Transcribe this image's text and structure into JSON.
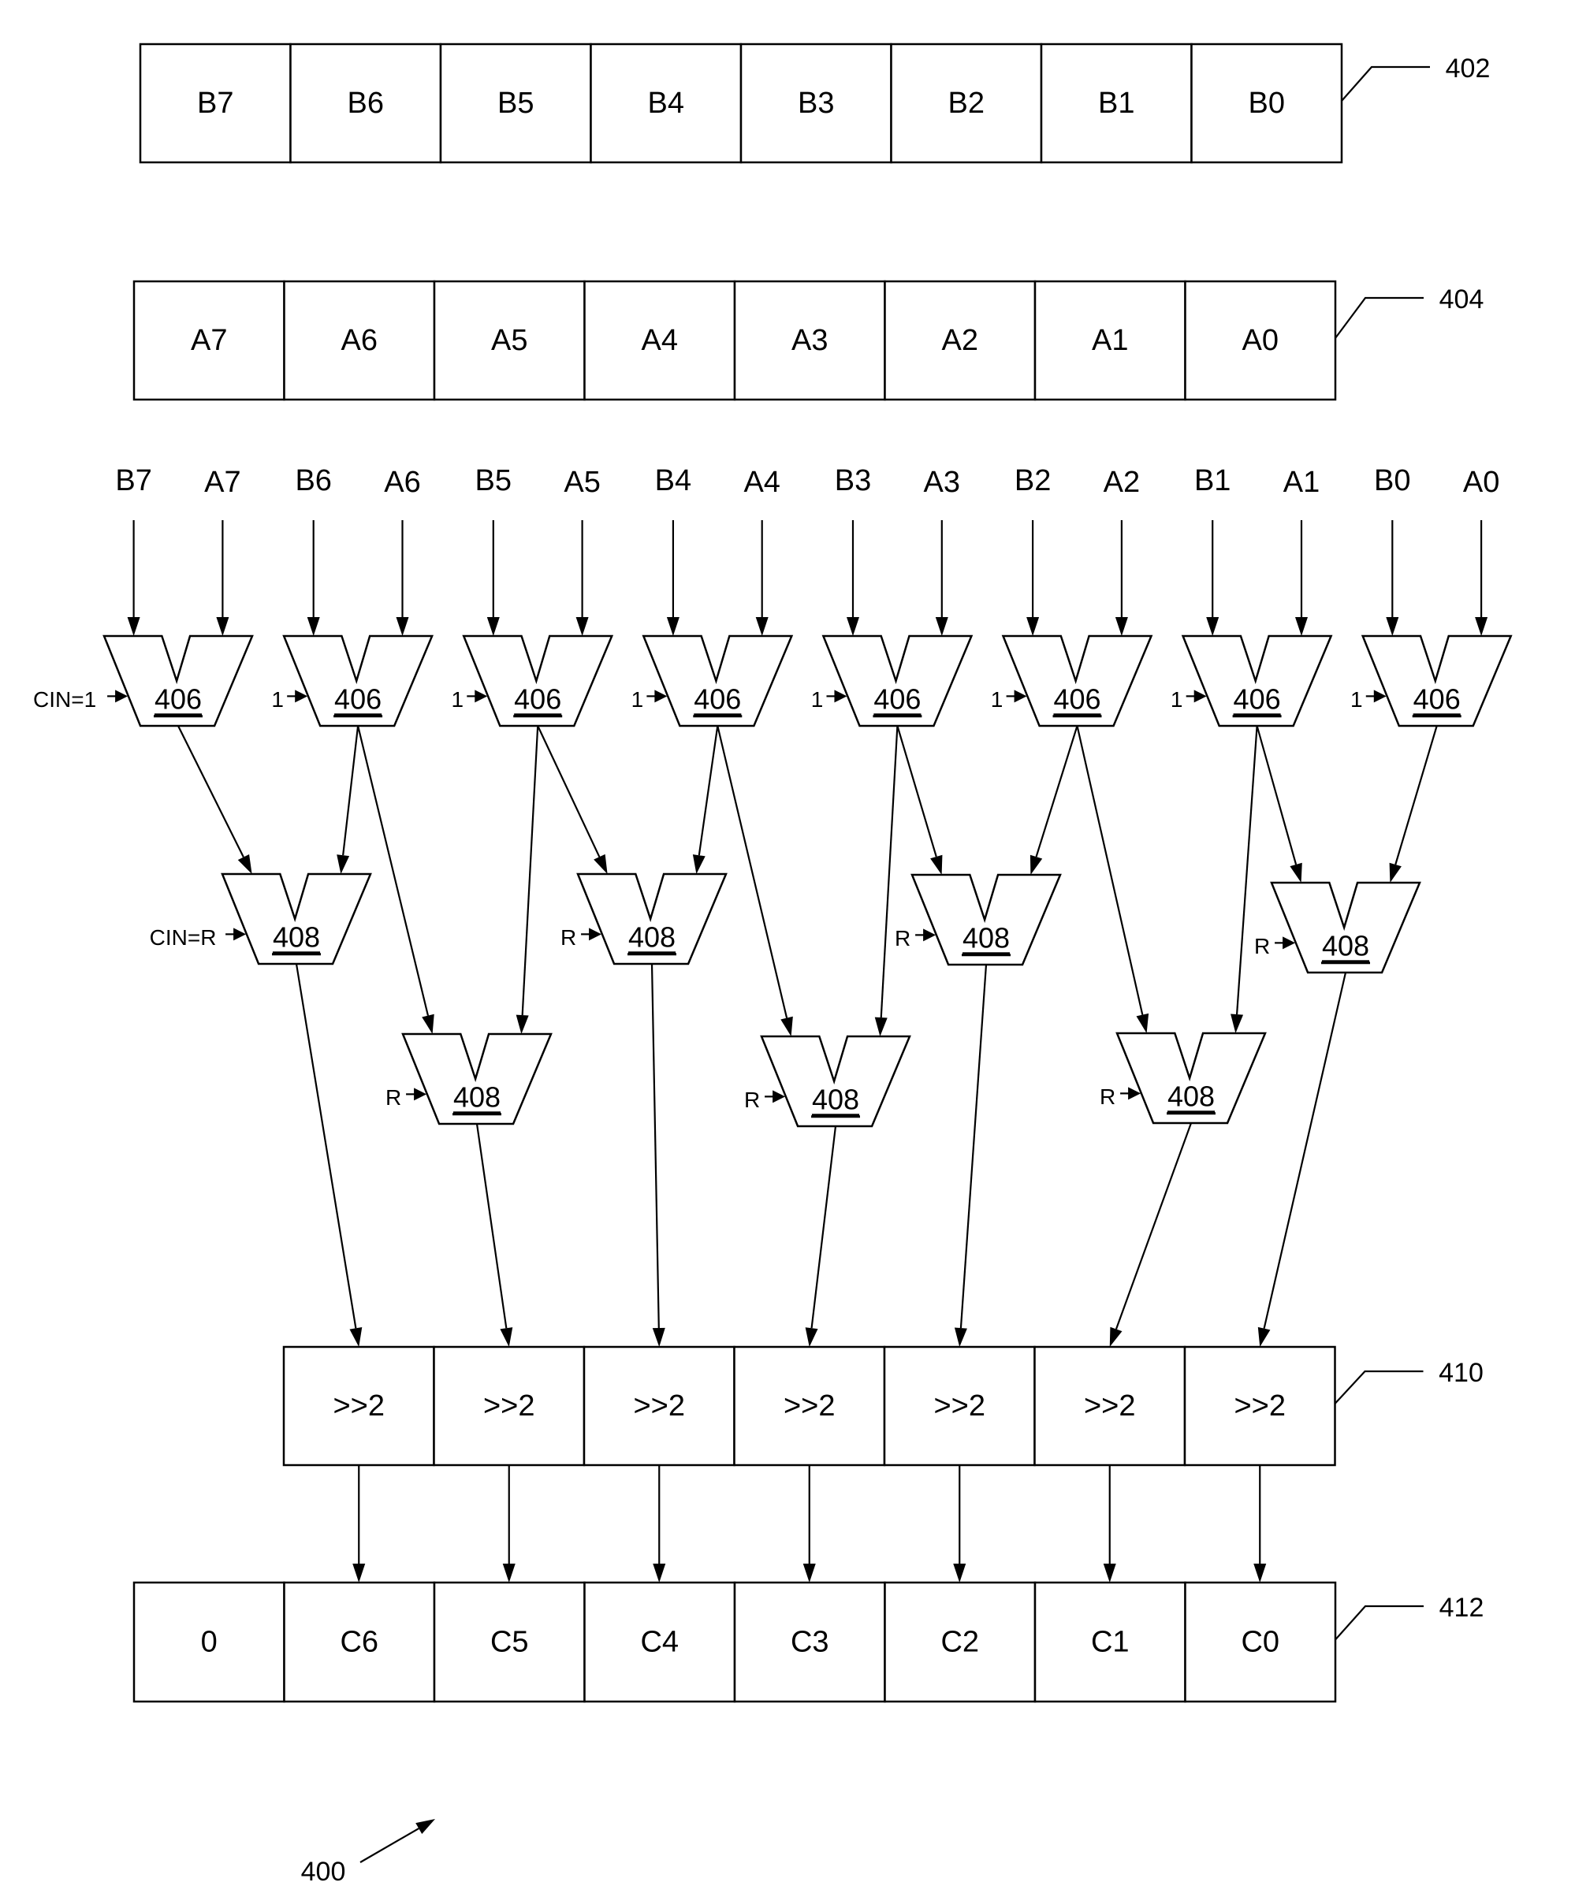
{
  "figure": {
    "reference": "400",
    "registers": {
      "b": {
        "ref": "402",
        "cells": [
          "B7",
          "B6",
          "B5",
          "B4",
          "B3",
          "B2",
          "B1",
          "B0"
        ]
      },
      "a": {
        "ref": "404",
        "cells": [
          "A7",
          "A6",
          "A5",
          "A4",
          "A3",
          "A2",
          "A1",
          "A0"
        ]
      },
      "shift": {
        "ref": "410",
        "cells": [
          ">>2",
          ">>2",
          ">>2",
          ">>2",
          ">>2",
          ">>2",
          ">>2"
        ]
      },
      "output": {
        "ref": "412",
        "cells": [
          "0",
          "C6",
          "C5",
          "C4",
          "C3",
          "C2",
          "C1",
          "C0"
        ]
      }
    },
    "input_labels": [
      "B7",
      "A7",
      "B6",
      "A6",
      "B5",
      "A5",
      "B4",
      "A4",
      "B3",
      "A3",
      "B2",
      "A2",
      "B1",
      "A1",
      "B0",
      "A0"
    ],
    "first_stage_adders": {
      "ref": "406",
      "count": 8,
      "carry_in_labels": [
        "CIN=1",
        "1",
        "1",
        "1",
        "1",
        "1",
        "1",
        "1"
      ]
    },
    "second_stage_adders": {
      "ref": "408",
      "upper": {
        "count": 4,
        "carry_in_labels": [
          "CIN=R",
          "R",
          "R",
          "R"
        ],
        "inputs": [
          [
            0,
            1
          ],
          [
            2,
            3
          ],
          [
            4,
            5
          ],
          [
            6,
            7
          ]
        ],
        "output_to_shift_cell": [
          0,
          2,
          4,
          6
        ]
      },
      "lower": {
        "count": 3,
        "carry_in_labels": [
          "R",
          "R",
          "R"
        ],
        "inputs": [
          [
            1,
            2
          ],
          [
            3,
            4
          ],
          [
            5,
            6
          ]
        ],
        "output_to_shift_cell": [
          1,
          3,
          5
        ]
      }
    }
  }
}
